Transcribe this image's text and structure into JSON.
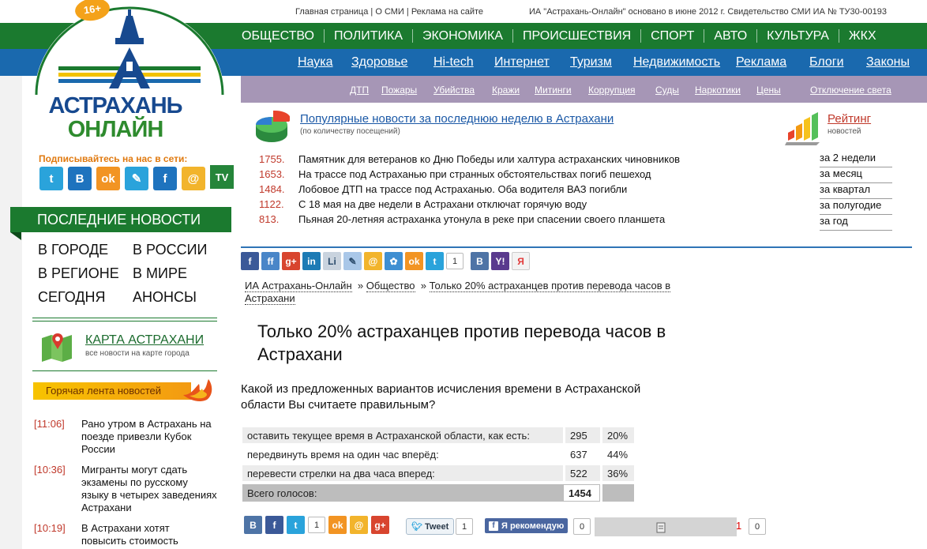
{
  "top": {
    "links": [
      "Главная страница",
      "О СМИ",
      "Реклама на сайте"
    ],
    "info": "ИА \"Астрахань-Онлайн\" основано в июне 2012 г. Свидетельство СМИ ИА № ТУ30-00193"
  },
  "logo": {
    "age_badge": "16+",
    "line1": "АСТРАХАНЬ",
    "line2": "ОНЛАЙН"
  },
  "nav_main": [
    "ОБЩЕСТВО",
    "ПОЛИТИКА",
    "ЭКОНОМИКА",
    "ПРОИСШЕСТВИЯ",
    "СПОРТ",
    "АВТО",
    "КУЛЬТУРА",
    "ЖКХ"
  ],
  "nav_sub": [
    "Наука",
    "Здоровье",
    "Hi-tech",
    "Интернет",
    "Туризм",
    "Недвижимость",
    "Реклама",
    "Блоги",
    "Законы"
  ],
  "nav_tags": [
    "ДТП",
    "Пожары",
    "Убийства",
    "Кражи",
    "Митинги",
    "Коррупция",
    "Суды",
    "Наркотики",
    "Цены",
    "Отключение света"
  ],
  "sidebar": {
    "subscribe_label": "Подписывайтесь на нас в сети:",
    "social": [
      {
        "icon": "twitter-icon",
        "glyph": "t",
        "color": "#2aa3db"
      },
      {
        "icon": "vkontakte-icon",
        "glyph": "В",
        "color": "#1e73be"
      },
      {
        "icon": "odnoklassniki-icon",
        "glyph": "ok",
        "color": "#f29423"
      },
      {
        "icon": "livejournal-icon",
        "glyph": "✎",
        "color": "#2aa3db"
      },
      {
        "icon": "facebook-icon",
        "glyph": "f",
        "color": "#1e73be"
      },
      {
        "icon": "mail-icon",
        "glyph": "@",
        "color": "#f2b42c"
      }
    ],
    "tv_label": "TV",
    "last_news": "ПОСЛЕДНИЕ НОВОСТИ",
    "categories": [
      "В ГОРОДЕ",
      "В РОССИИ",
      "В РЕГИОНЕ",
      "В МИРЕ",
      "СЕГОДНЯ",
      "АНОНСЫ"
    ],
    "map_title": "КАРТА АСТРАХАНИ",
    "map_sub": "все новости на карте города",
    "hot_feed": "Горячая лента новостей",
    "hot_items": [
      {
        "time": "[11:06]",
        "text": "Рано утром в Астрахань на поезде привезли Кубок России"
      },
      {
        "time": "[10:36]",
        "text": "Мигранты могут сдать экзамены по русскому языку в четырех заведениях Астрахани"
      },
      {
        "time": "[10:19]",
        "text": "В Астрахани хотят повысить стоимость"
      }
    ]
  },
  "popular": {
    "title": "Популярные новости за последнюю неделю в Астрахани",
    "subtitle": "(по количеству посещений)",
    "rating_title": "Рейтинг",
    "rating_sub": "новостей",
    "items": [
      {
        "count": "1755.",
        "text": "Памятник для ветеранов ко Дню Победы или халтура астраханских чиновников"
      },
      {
        "count": "1653.",
        "text": "На трассе под Астраханью при странных обстоятельствах погиб пешеход"
      },
      {
        "count": "1484.",
        "text": "Лобовое ДТП на трассе под Астраханью. Оба водителя ВАЗ погибли"
      },
      {
        "count": "1122.",
        "text": "С 18 мая на две недели в Астрахани отключат горячую воду"
      },
      {
        "count": "813.",
        "text": "Пьяная 20-летняя астраханка утонула в реке при спасении своего планшета"
      }
    ],
    "periods": [
      "за 2 недели",
      "за месяц",
      "за квартал",
      "за полугодие",
      "за год"
    ]
  },
  "share_top": {
    "buttons": [
      {
        "icon": "facebook-icon",
        "glyph": "f",
        "color": "#3b5998"
      },
      {
        "icon": "friendfeed-icon",
        "glyph": "ff",
        "color": "#4a86c8"
      },
      {
        "icon": "google-plus-icon",
        "glyph": "g+",
        "color": "#d8452f"
      },
      {
        "icon": "linkedin-icon",
        "glyph": "in",
        "color": "#1d7bb5"
      },
      {
        "icon": "liveinternet-icon",
        "glyph": "Li",
        "color": "#c9d3de"
      },
      {
        "icon": "livejournal-icon",
        "glyph": "✎",
        "color": "#a9c7e8"
      },
      {
        "icon": "mail-icon",
        "glyph": "@",
        "color": "#f2b42c"
      },
      {
        "icon": "moi-krug-icon",
        "glyph": "✿",
        "color": "#3f8fd2"
      },
      {
        "icon": "odnoklassniki-icon",
        "glyph": "ok",
        "color": "#f29423"
      },
      {
        "icon": "twitter-icon",
        "glyph": "t",
        "color": "#2aa3db"
      }
    ],
    "twitter_count": "1",
    "buttons_after": [
      {
        "icon": "vkontakte-icon",
        "glyph": "В",
        "color": "#4e74a6"
      },
      {
        "icon": "yahoo-icon",
        "glyph": "Y!",
        "color": "#5a3a8e"
      },
      {
        "icon": "yandex-icon",
        "glyph": "Я",
        "color": "#e23b3b"
      }
    ]
  },
  "breadcrumb": {
    "home": "ИА Астрахань-Онлайн",
    "section": "Общество",
    "current": "Только 20% астраханцев против перевода часов в Астрахани",
    "sep": "»"
  },
  "article": {
    "title": "Только 20% астраханцев против перевода часов в Астрахани",
    "question": "Какой из предложенных вариантов исчисления времени в Астраханской области Вы считаете правильным?"
  },
  "poll": {
    "rows": [
      {
        "option": "оставить текущее время в Астраханской области, как есть:",
        "votes": "295",
        "percent": "20%"
      },
      {
        "option": "передвинуть время на один час вперёд:",
        "votes": "637",
        "percent": "44%"
      },
      {
        "option": "перевести стрелки на два часа вперед:",
        "votes": "522",
        "percent": "36%"
      }
    ],
    "total_label": "Всего голосов:",
    "total_votes": "1454"
  },
  "share_bottom": {
    "buttons": [
      {
        "icon": "vkontakte-icon",
        "glyph": "В",
        "color": "#4e74a6"
      },
      {
        "icon": "facebook-icon",
        "glyph": "f",
        "color": "#3b5998"
      },
      {
        "icon": "twitter-icon",
        "glyph": "t",
        "color": "#2aa3db"
      }
    ],
    "twitter_count": "1",
    "buttons_after": [
      {
        "icon": "odnoklassniki-icon",
        "glyph": "ok",
        "color": "#f29423"
      },
      {
        "icon": "mail-icon",
        "glyph": "@",
        "color": "#f2b42c"
      },
      {
        "icon": "google-plus-icon",
        "glyph": "g+",
        "color": "#d8452f"
      }
    ],
    "tweet_label": "Tweet",
    "tweet_count": "1",
    "fb_label": "Я рекомендую",
    "fb_count": "0",
    "red_count": "1",
    "last_count": "0"
  }
}
